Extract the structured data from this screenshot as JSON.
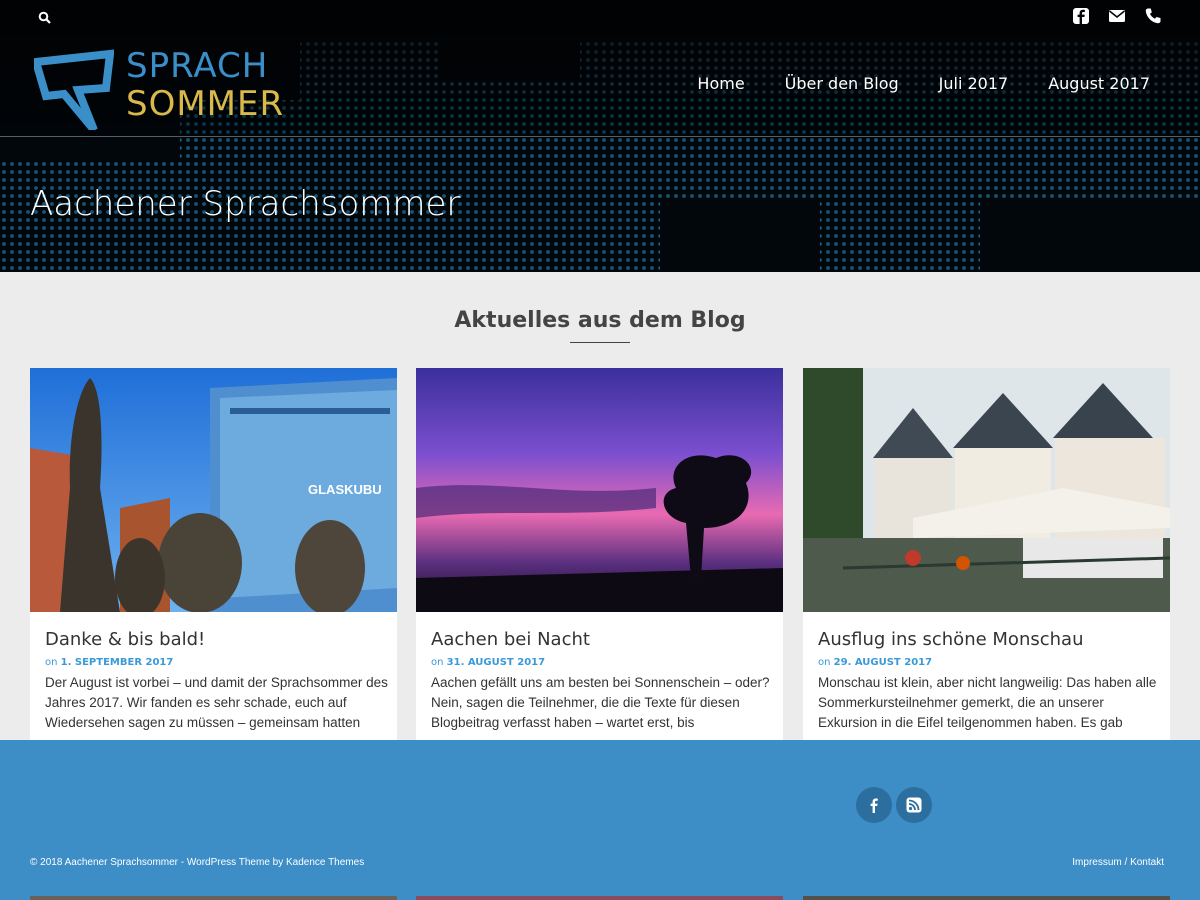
{
  "header": {
    "logo": {
      "line1": "SPRACH",
      "line2": "SOMMER"
    },
    "icons": [
      "search-icon",
      "facebook-icon",
      "mail-icon",
      "phone-icon"
    ],
    "nav": [
      {
        "label": "Home"
      },
      {
        "label": "Über den Blog"
      },
      {
        "label": "Juli 2017"
      },
      {
        "label": "August 2017"
      }
    ],
    "page_title": "Aachener Sprachsommer"
  },
  "blog": {
    "section_title": "Aktuelles aus dem Blog",
    "posts": [
      {
        "title": "Danke & bis bald!",
        "meta_prefix": "on",
        "date": "1. SEPTEMBER 2017",
        "excerpt": "Der August ist vorbei – und damit der Sprachsommer des Jahres 2017. Wir fanden es sehr schade, euch auf Wiedersehen sagen zu müssen – gemeinsam hatten"
      },
      {
        "title": "Aachen bei Nacht",
        "meta_prefix": "on",
        "date": "31. AUGUST 2017",
        "excerpt": "Aachen gefällt uns am besten bei Sonnenschein – oder? Nein, sagen die Teilnehmer, die die Texte für diesen Blogbeitrag verfasst haben – wartet erst, bis"
      },
      {
        "title": "Ausflug ins schöne Monschau",
        "meta_prefix": "on",
        "date": "29. AUGUST 2017",
        "excerpt": "Monschau ist klein, aber nicht langweilig: Das haben alle Sommerkursteilnehmer gemerkt, die an unserer Exkursion in die Eifel teilgenommen haben. Es gab"
      }
    ]
  },
  "footer": {
    "social_icons": [
      "facebook-icon",
      "rss-icon"
    ],
    "copyright": "© 2018 Aachener Sprachsommer - WordPress Theme by Kadence Themes",
    "links": [
      {
        "label": "Impressum"
      },
      {
        "label": "Kontakt"
      }
    ],
    "link_separator": " / "
  },
  "colors": {
    "brand_blue": "#3b8fc8",
    "brand_gold": "#d9b94a",
    "footer_blue": "#3d8dc7",
    "meta_blue": "#3a9ad9"
  }
}
